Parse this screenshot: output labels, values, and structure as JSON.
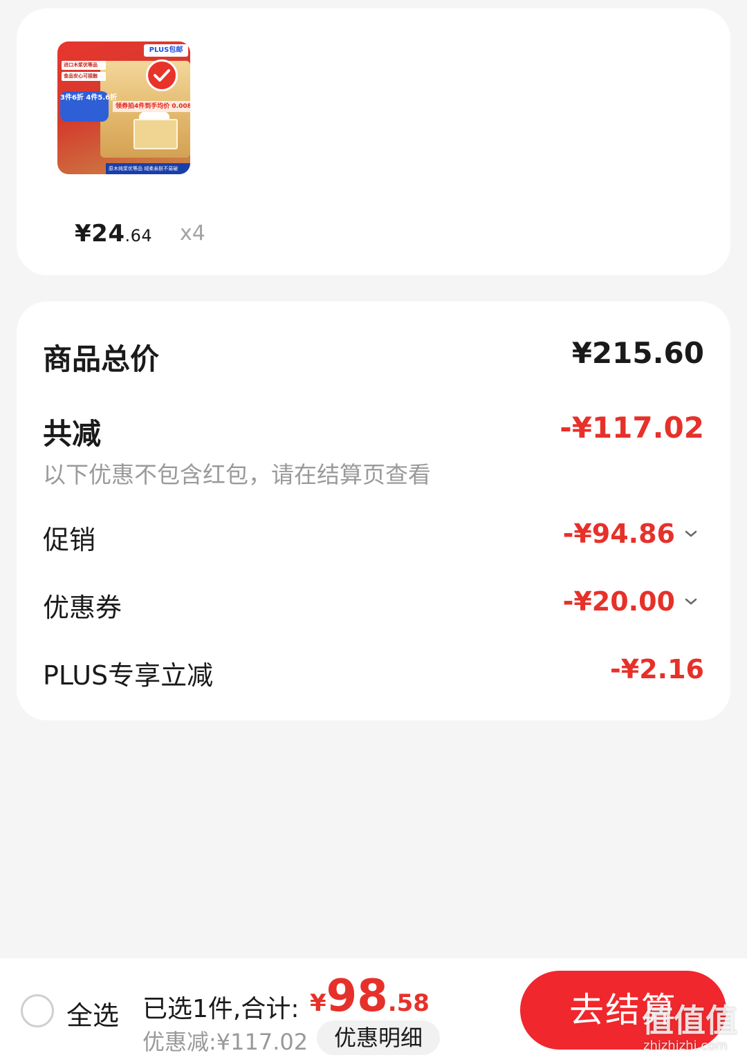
{
  "product": {
    "image_name": "tissue-product-image",
    "image_texts": {
      "promo_line1": "进口木浆优等品",
      "promo_line2": "食品安心可接触",
      "promo_pill": "3件6折 4件5.6折",
      "plus_tag": "PLUS包邮",
      "price_strip": "领券拍4件到手均价 0.0084",
      "bottom_strip": "原木纯浆优等品 绒柔亲肤不易破"
    },
    "price_int": "¥24",
    "price_dec": ".64",
    "quantity": "x4"
  },
  "summary": {
    "total_label": "商品总价",
    "total_value": "¥215.60",
    "discount_label": "共减",
    "discount_value": "-¥117.02",
    "note": "以下优惠不包含红包，请在结算页查看",
    "items": [
      {
        "label": "促销",
        "value": "-¥94.86",
        "expandable": true
      },
      {
        "label": "优惠券",
        "value": "-¥20.00",
        "expandable": true
      },
      {
        "label": "PLUS专享立减",
        "value": "-¥2.16",
        "expandable": false
      }
    ]
  },
  "bottom_bar": {
    "select_all_label": "全选",
    "summary_prefix": "已选1件,合计:",
    "total_currency": "¥",
    "total_int": "98",
    "total_dec": ".58",
    "saved_text": "优惠减:¥117.02",
    "detail_chip": "优惠明细",
    "checkout_label": "去结算"
  },
  "watermark": {
    "logo": "值值值",
    "url": "zhizhizhi.com"
  },
  "colors": {
    "accent": "#e6312a",
    "checkout": "#f0272c",
    "background": "#f5f5f5"
  }
}
